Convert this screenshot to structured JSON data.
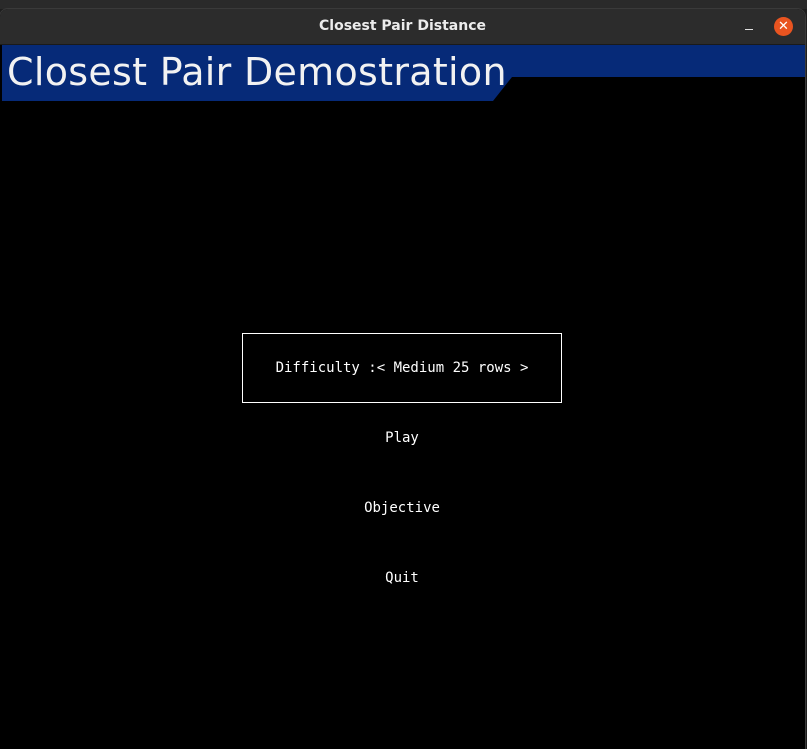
{
  "window": {
    "title": "Closest Pair Distance",
    "minimize_symbol": "–",
    "close_symbol": "✕"
  },
  "banner": {
    "title": "Closest Pair Demostration",
    "color": "#062a78"
  },
  "menu": {
    "difficulty_label": "Difficulty :< Medium 25 rows >",
    "play_label": "Play",
    "objective_label": "Objective",
    "quit_label": "Quit"
  },
  "colors": {
    "background": "#000000",
    "text": "#ffffff",
    "close_button": "#e95420",
    "titlebar": "#2c2c2c"
  }
}
